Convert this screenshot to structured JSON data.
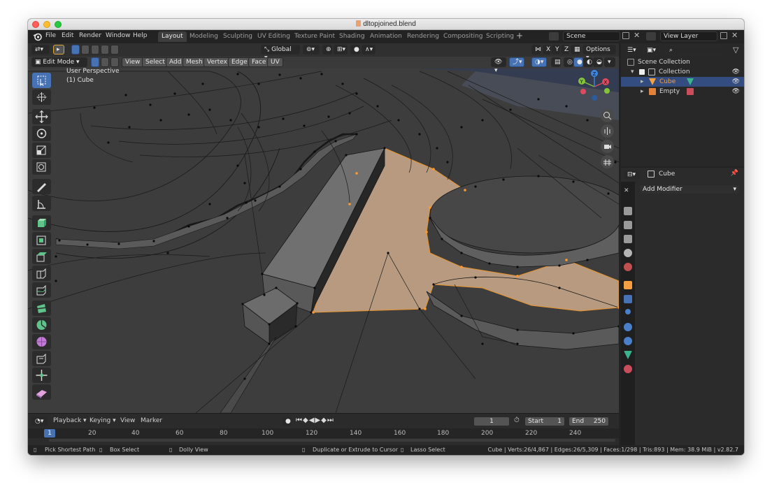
{
  "window": {
    "title": "dltopjoined.blend"
  },
  "menu": [
    "File",
    "Edit",
    "Render",
    "Window",
    "Help"
  ],
  "workspaces": [
    "Layout",
    "Modeling",
    "Sculpting",
    "UV Editing",
    "Texture Paint",
    "Shading",
    "Animation",
    "Rendering",
    "Compositing",
    "Scripting"
  ],
  "active_workspace": "Layout",
  "scene": {
    "name": "Scene",
    "view_layer": "View Layer"
  },
  "viewport_header": {
    "transform_orientation": "Global",
    "options_label": "Options",
    "axes": [
      "X",
      "Y",
      "Z"
    ],
    "mode": "Edit Mode",
    "menus": [
      "View",
      "Select",
      "Add",
      "Mesh",
      "Vertex",
      "Edge",
      "Face",
      "UV"
    ]
  },
  "viewport": {
    "perspective_label": "User Perspective",
    "object_label": "(1) Cube",
    "gizmo_axes": [
      "X",
      "Y",
      "Z"
    ]
  },
  "tools": [
    "select-box",
    "cursor",
    "move",
    "rotate",
    "scale",
    "transform",
    "annotate",
    "measure",
    "add-cube",
    "extrude-region",
    "inset-faces",
    "bevel",
    "loop-cut",
    "knife",
    "poly-build",
    "spin",
    "smooth",
    "edge-slide",
    "shrink-fatten",
    "shear"
  ],
  "outliner": {
    "search_placeholder": "",
    "root": "Scene Collection",
    "collection": "Collection",
    "items": [
      {
        "name": "Cube",
        "selected": true
      },
      {
        "name": "Empty",
        "selected": false
      }
    ]
  },
  "properties": {
    "object_name": "Cube",
    "add_modifier_label": "Add Modifier"
  },
  "timeline": {
    "menus": [
      "Playback",
      "Keying",
      "View",
      "Marker"
    ],
    "current_frame": "1",
    "start_label": "Start",
    "start_value": "1",
    "end_label": "End",
    "end_value": "250",
    "ruler": [
      "1",
      "20",
      "40",
      "60",
      "80",
      "100",
      "120",
      "140",
      "160",
      "180",
      "200",
      "220",
      "240"
    ]
  },
  "status": {
    "hints": [
      "Pick Shortest Path",
      "Box Select",
      "Dolly View",
      "Duplicate or Extrude to Cursor",
      "Lasso Select"
    ],
    "stats": "Cube | Verts:26/4,867 | Edges:26/5,309 | Faces:1/298 | Tris:893 | Mem: 38.9 MiB | v2.82.7"
  },
  "colors": {
    "accent": "#4772b3",
    "viewport_bg": "#393939",
    "selected_face": "#c7a88c",
    "selected_edge": "#e8932c",
    "object_orange": "#f5a142"
  }
}
